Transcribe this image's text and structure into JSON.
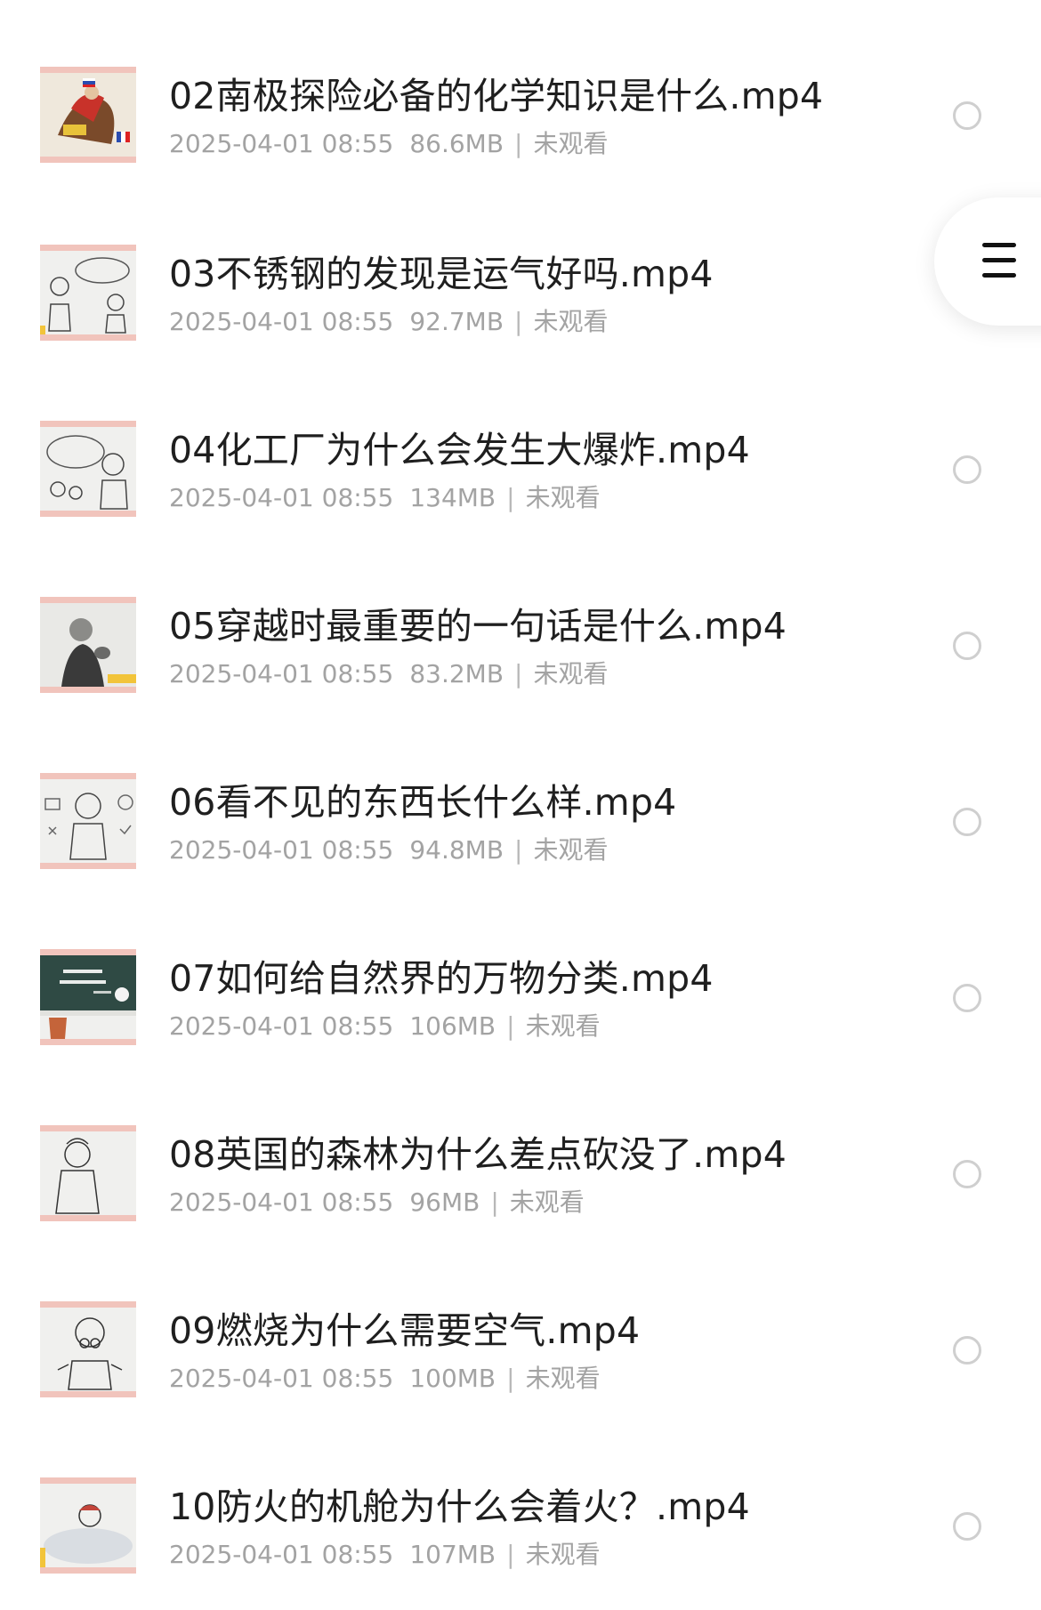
{
  "menu": {
    "icon": "hamburger-menu-icon"
  },
  "items": [
    {
      "title": "02南极探险必备的化学知识是什么.mp4",
      "date": "2025-04-01 08:55",
      "size": "86.6MB",
      "sep": "|",
      "status": "未观看",
      "thumb": "thumbnail-napoleon"
    },
    {
      "title": "03不锈钢的发现是运气好吗.mp4",
      "date": "2025-04-01 08:55",
      "size": "92.7MB",
      "sep": "|",
      "status": "未观看",
      "thumb": "thumbnail-sketch"
    },
    {
      "title": "04化工厂为什么会发生大爆炸.mp4",
      "date": "2025-04-01 08:55",
      "size": "134MB",
      "sep": "|",
      "status": "未观看",
      "thumb": "thumbnail-sketch"
    },
    {
      "title": "05穿越时最重要的一句话是什么.mp4",
      "date": "2025-04-01 08:55",
      "size": "83.2MB",
      "sep": "|",
      "status": "未观看",
      "thumb": "thumbnail-photo"
    },
    {
      "title": "06看不见的东西长什么样.mp4",
      "date": "2025-04-01 08:55",
      "size": "94.8MB",
      "sep": "|",
      "status": "未观看",
      "thumb": "thumbnail-sketch"
    },
    {
      "title": "07如何给自然界的万物分类.mp4",
      "date": "2025-04-01 08:55",
      "size": "106MB",
      "sep": "|",
      "status": "未观看",
      "thumb": "thumbnail-blackboard"
    },
    {
      "title": "08英国的森林为什么差点砍没了.mp4",
      "date": "2025-04-01 08:55",
      "size": "96MB",
      "sep": "|",
      "status": "未观看",
      "thumb": "thumbnail-sketch"
    },
    {
      "title": "09燃烧为什么需要空气.mp4",
      "date": "2025-04-01 08:55",
      "size": "100MB",
      "sep": "|",
      "status": "未观看",
      "thumb": "thumbnail-sketch"
    },
    {
      "title": "10防火的机舱为什么会着火？.mp4",
      "date": "2025-04-01 08:55",
      "size": "107MB",
      "sep": "|",
      "status": "未观看",
      "thumb": "thumbnail-sketch"
    }
  ]
}
